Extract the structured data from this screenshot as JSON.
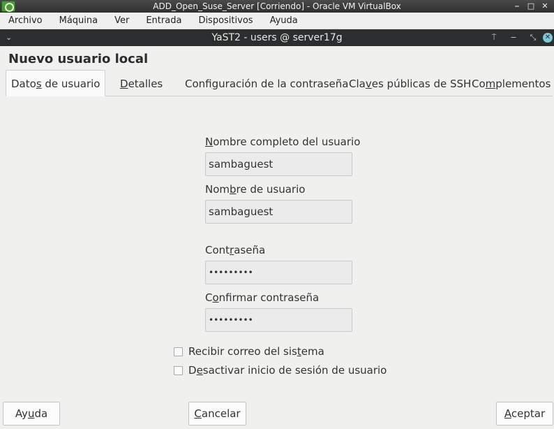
{
  "host_window": {
    "title": "ADD_Open_Suse_Server [Corriendo] - Oracle VM VirtualBox",
    "min_glyph": "⎯",
    "max_glyph": "□",
    "close_glyph": "✕",
    "menu": [
      "Archivo",
      "Máquina",
      "Ver",
      "Entrada",
      "Dispositivos",
      "Ayuda"
    ]
  },
  "yast_window": {
    "title": "YaST2 - users @ server17g",
    "menu_glyph": "⌄",
    "pin_glyph": "⍑",
    "min_glyph": "−",
    "restore_glyph": "⤡",
    "close_glyph": "✕"
  },
  "dialog": {
    "heading": "Nuevo usuario local",
    "tabs": [
      {
        "pre": "Dato",
        "u": "s",
        "post": " de usuario"
      },
      {
        "pre": "",
        "u": "D",
        "post": "etalles"
      },
      {
        "pre": "Confi",
        "u": "g",
        "post": "uración de la contraseña"
      },
      {
        "pre": "Cla",
        "u": "v",
        "post": "es públicas de SSH"
      },
      {
        "pre": "Co",
        "u": "m",
        "post": "plementos"
      }
    ],
    "fields": {
      "full_name": {
        "label_pre": "",
        "label_u": "N",
        "label_post": "ombre completo del usuario",
        "value": "sambaguest"
      },
      "username": {
        "label_pre": "Nom",
        "label_u": "b",
        "label_post": "re de usuario",
        "value": "sambaguest"
      },
      "password": {
        "label_pre": "Cont",
        "label_u": "r",
        "label_post": "aseña",
        "value": "•••••••••"
      },
      "confirm_password": {
        "label_pre": "C",
        "label_u": "o",
        "label_post": "nfirmar contraseña",
        "value": "•••••••••"
      }
    },
    "checkboxes": [
      {
        "pre": "Recibir correo del sis",
        "u": "t",
        "post": "ema",
        "checked": false
      },
      {
        "pre": "D",
        "u": "e",
        "post": "sactivar inicio de sesión de usuario",
        "checked": false
      }
    ],
    "buttons": {
      "help": {
        "pre": "Ay",
        "u": "u",
        "post": "da"
      },
      "cancel": {
        "pre": "",
        "u": "C",
        "post": "ancelar"
      },
      "accept": {
        "pre": "",
        "u": "A",
        "post": "ceptar"
      }
    }
  }
}
